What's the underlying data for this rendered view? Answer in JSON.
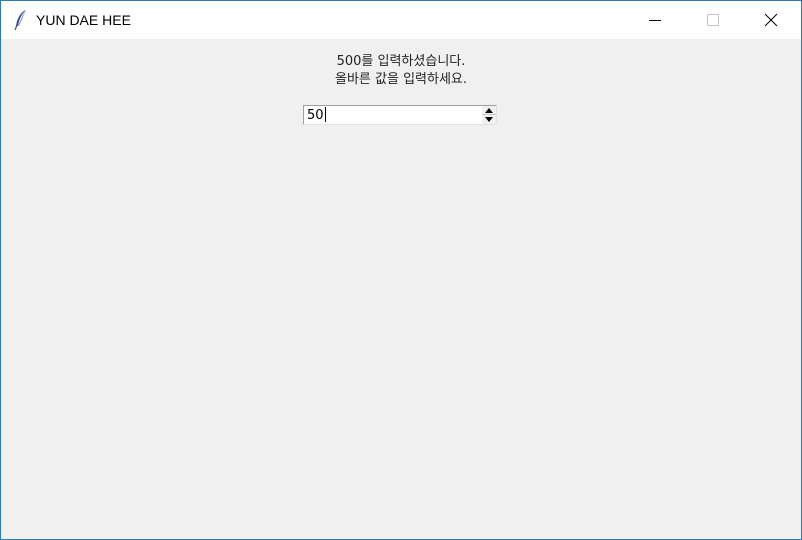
{
  "window": {
    "title": "YUN DAE HEE",
    "icon": "feather-icon",
    "controls": [
      "minimize-icon",
      "maximize-icon",
      "close-icon"
    ],
    "border_color": "#2b7bb9"
  },
  "message": {
    "line1": "500를 입력하셨습니다.",
    "line2": "올바른 값을 입력하세요."
  },
  "spinbox": {
    "value": "50"
  }
}
